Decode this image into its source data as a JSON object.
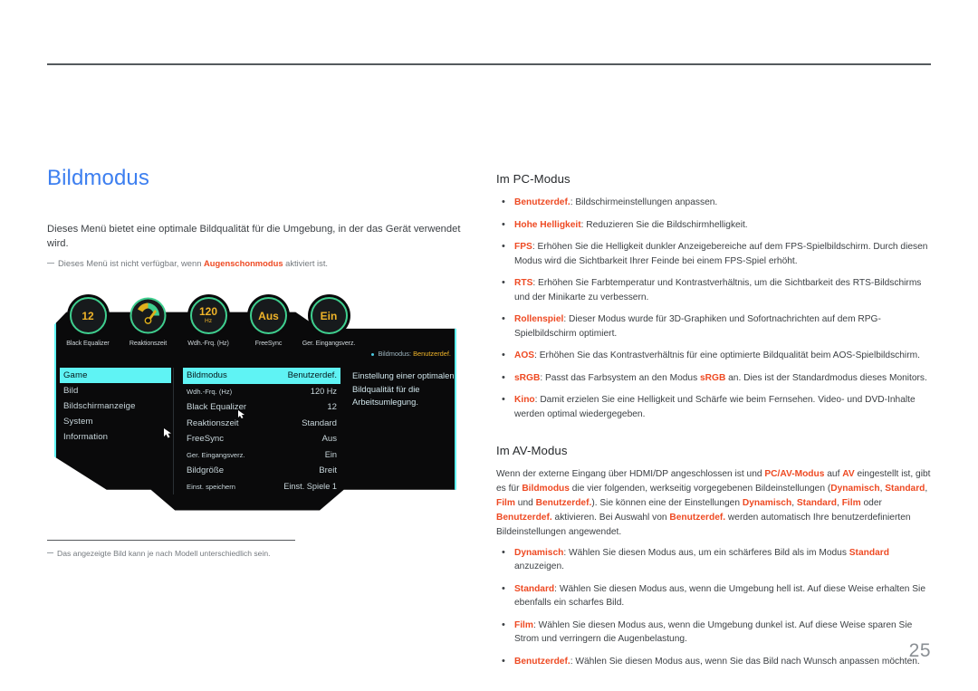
{
  "page": {
    "number": "25"
  },
  "left": {
    "title": "Bildmodus",
    "intro": "Dieses Menü bietet eine optimale Bildqualität für die Umgebung, in der das Gerät verwendet wird.",
    "note_pre": "Dieses Menü ist nicht verfügbar, wenn ",
    "note_hl": "Augenschonmodus",
    "note_post": " aktiviert ist.",
    "footnote": "Das angezeigte Bild kann je nach Modell unterschiedlich sein."
  },
  "osd": {
    "dials": [
      {
        "value": "12",
        "unit": "",
        "label": "Black Equalizer",
        "type": "value"
      },
      {
        "value": "",
        "unit": "",
        "label": "Reaktionszeit",
        "type": "gauge"
      },
      {
        "value": "120",
        "unit": "Hz",
        "label": "Wdh.-Frq. (Hz)",
        "type": "value"
      },
      {
        "value": "Aus",
        "unit": "",
        "label": "FreeSync",
        "type": "value"
      },
      {
        "value": "Ein",
        "unit": "",
        "label": "Ger. Eingangsverz.",
        "type": "value"
      }
    ],
    "hint_label": "Bildmodus:",
    "hint_value": "Benutzerdef.",
    "nav": [
      {
        "label": "Game",
        "selected": true
      },
      {
        "label": "Bild",
        "selected": false
      },
      {
        "label": "Bildschirmanzeige",
        "selected": false
      },
      {
        "label": "System",
        "selected": false
      },
      {
        "label": "Information",
        "selected": false
      }
    ],
    "settings": [
      {
        "label": "Bildmodus",
        "value": "Benutzerdef.",
        "selected": true,
        "small": false
      },
      {
        "label": "Wdh.-Frq. (Hz)",
        "value": "120 Hz",
        "selected": false,
        "small": true
      },
      {
        "label": "Black Equalizer",
        "value": "12",
        "selected": false,
        "small": false
      },
      {
        "label": "Reaktionszeit",
        "value": "Standard",
        "selected": false,
        "small": false
      },
      {
        "label": "FreeSync",
        "value": "Aus",
        "selected": false,
        "small": false
      },
      {
        "label": "Ger. Eingangsverz.",
        "value": "Ein",
        "selected": false,
        "small": true
      },
      {
        "label": "Bildgröße",
        "value": "Breit",
        "selected": false,
        "small": false
      },
      {
        "label": "Einst. speichern",
        "value": "Einst. Spiele 1",
        "selected": false,
        "small": true
      }
    ],
    "description": "Einstellung einer optimalen Bildqualität für die Arbeitsumlegung."
  },
  "right": {
    "pc_heading": "Im PC-Modus",
    "pc_items": [
      {
        "term": "Benutzerdef.",
        "sep": ": ",
        "text": "Bildschirmeinstellungen anpassen."
      },
      {
        "term": "Hohe Helligkeit",
        "sep": ": ",
        "text": "Reduzieren Sie die Bildschirmhelligkeit."
      },
      {
        "term": "FPS",
        "sep": ": ",
        "text": "Erhöhen Sie die Helligkeit dunkler Anzeigebereiche auf dem FPS-Spielbildschirm. Durch diesen Modus wird die Sichtbarkeit Ihrer Feinde bei einem FPS-Spiel erhöht."
      },
      {
        "term": "RTS",
        "sep": ": ",
        "text": "Erhöhen Sie Farbtemperatur und Kontrastverhältnis, um die Sichtbarkeit des RTS-Bildschirms und der Minikarte zu verbessern."
      },
      {
        "term": "Rollenspiel",
        "sep": ": ",
        "text": "Dieser Modus wurde für 3D-Graphiken und Sofortnachrichten auf dem RPG-Spielbildschirm optimiert."
      },
      {
        "term": "AOS",
        "sep": ": ",
        "text": "Erhöhen Sie das Kontrastverhältnis für eine optimierte Bildqualität beim AOS-Spielbildschirm."
      },
      {
        "term": "sRGB",
        "sep": ": ",
        "text": "Passt das Farbsystem an den Modus sRGB an. Dies ist der Standardmodus dieses Monitors."
      },
      {
        "term": "Kino",
        "sep": ": ",
        "text": "Damit erzielen Sie eine Helligkeit und Schärfe wie beim Fernsehen. Video- und DVD-Inhalte werden optimal wiedergegeben."
      }
    ],
    "av_heading": "Im AV-Modus",
    "av_paragraph": "Wenn der externe Eingang über HDMI/DP angeschlossen ist und PC/AV-Modus auf AV eingestellt ist, gibt es für Bildmodus die vier folgenden, werkseitig vorgegebenen Bildeinstellungen (Dynamisch, Standard, Film und Benutzerdef.). Sie können eine der Einstellungen Dynamisch, Standard, Film oder Benutzerdef. aktivieren. Bei Auswahl von Benutzerdef. werden automatisch Ihre benutzerdefinierten Bildeinstellungen angewendet.",
    "av_items": [
      {
        "term": "Dynamisch",
        "sep": ": ",
        "text": "Wählen Sie diesen Modus aus, um ein schärferes Bild als im Modus Standard anzuzeigen."
      },
      {
        "term": "Standard",
        "sep": ": ",
        "text": "Wählen Sie diesen Modus aus, wenn die Umgebung hell ist. Auf diese Weise erhalten Sie ebenfalls ein scharfes Bild."
      },
      {
        "term": "Film",
        "sep": ": ",
        "text": "Wählen Sie diesen Modus aus, wenn die Umgebung dunkel ist. Auf diese Weise sparen Sie Strom und verringern die Augenbelastung."
      },
      {
        "term": "Benutzerdef.",
        "sep": ": ",
        "text": "Wählen Sie diesen Modus aus, wenn Sie das Bild nach Wunsch anpassen möchten."
      }
    ]
  },
  "colors": {
    "title_blue": "#3d7ff0",
    "accent_orange": "#ee4a23",
    "osd_cyan": "#5ff3f4",
    "osd_green": "#3fcf8f",
    "osd_amber": "#f0b429",
    "body_text": "#3b3f43"
  }
}
